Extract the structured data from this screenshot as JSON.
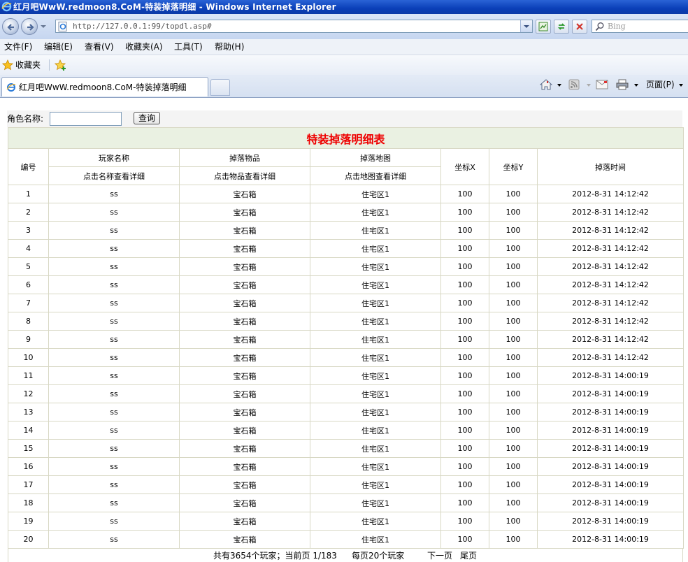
{
  "window": {
    "title": "红月吧WwW.redmoon8.CoM-特装掉落明细 - Windows Internet Explorer"
  },
  "address_bar": {
    "url": "http://127.0.0.1:99/topdl.asp#",
    "search_placeholder": "Bing"
  },
  "menu": [
    "文件(F)",
    "编辑(E)",
    "查看(V)",
    "收藏夹(A)",
    "工具(T)",
    "帮助(H)"
  ],
  "favorites_bar": {
    "label": "收藏夹"
  },
  "tab": {
    "title": "红月吧WwW.redmoon8.CoM-特装掉落明细"
  },
  "command_bar": {
    "page_label": "页面(P)"
  },
  "search": {
    "label": "角色名称:",
    "input_value": "",
    "button_label": "查询"
  },
  "table": {
    "caption": "特装掉落明细表",
    "headers": {
      "id": "编号",
      "player": "玩家名称",
      "player_hint": "点击名称查看详细",
      "item": "掉落物品",
      "item_hint": "点击物品查看详细",
      "map": "掉落地图",
      "map_hint": "点击地图查看详细",
      "x": "坐标X",
      "y": "坐标Y",
      "time": "掉落时间"
    },
    "rows": [
      {
        "id": "1",
        "player": "ss",
        "item": "宝石箱",
        "map": "住宅区1",
        "x": "100",
        "y": "100",
        "time": "2012-8-31 14:12:42"
      },
      {
        "id": "2",
        "player": "ss",
        "item": "宝石箱",
        "map": "住宅区1",
        "x": "100",
        "y": "100",
        "time": "2012-8-31 14:12:42"
      },
      {
        "id": "3",
        "player": "ss",
        "item": "宝石箱",
        "map": "住宅区1",
        "x": "100",
        "y": "100",
        "time": "2012-8-31 14:12:42"
      },
      {
        "id": "4",
        "player": "ss",
        "item": "宝石箱",
        "map": "住宅区1",
        "x": "100",
        "y": "100",
        "time": "2012-8-31 14:12:42"
      },
      {
        "id": "5",
        "player": "ss",
        "item": "宝石箱",
        "map": "住宅区1",
        "x": "100",
        "y": "100",
        "time": "2012-8-31 14:12:42"
      },
      {
        "id": "6",
        "player": "ss",
        "item": "宝石箱",
        "map": "住宅区1",
        "x": "100",
        "y": "100",
        "time": "2012-8-31 14:12:42"
      },
      {
        "id": "7",
        "player": "ss",
        "item": "宝石箱",
        "map": "住宅区1",
        "x": "100",
        "y": "100",
        "time": "2012-8-31 14:12:42"
      },
      {
        "id": "8",
        "player": "ss",
        "item": "宝石箱",
        "map": "住宅区1",
        "x": "100",
        "y": "100",
        "time": "2012-8-31 14:12:42"
      },
      {
        "id": "9",
        "player": "ss",
        "item": "宝石箱",
        "map": "住宅区1",
        "x": "100",
        "y": "100",
        "time": "2012-8-31 14:12:42"
      },
      {
        "id": "10",
        "player": "ss",
        "item": "宝石箱",
        "map": "住宅区1",
        "x": "100",
        "y": "100",
        "time": "2012-8-31 14:12:42"
      },
      {
        "id": "11",
        "player": "ss",
        "item": "宝石箱",
        "map": "住宅区1",
        "x": "100",
        "y": "100",
        "time": "2012-8-31 14:00:19"
      },
      {
        "id": "12",
        "player": "ss",
        "item": "宝石箱",
        "map": "住宅区1",
        "x": "100",
        "y": "100",
        "time": "2012-8-31 14:00:19"
      },
      {
        "id": "13",
        "player": "ss",
        "item": "宝石箱",
        "map": "住宅区1",
        "x": "100",
        "y": "100",
        "time": "2012-8-31 14:00:19"
      },
      {
        "id": "14",
        "player": "ss",
        "item": "宝石箱",
        "map": "住宅区1",
        "x": "100",
        "y": "100",
        "time": "2012-8-31 14:00:19"
      },
      {
        "id": "15",
        "player": "ss",
        "item": "宝石箱",
        "map": "住宅区1",
        "x": "100",
        "y": "100",
        "time": "2012-8-31 14:00:19"
      },
      {
        "id": "16",
        "player": "ss",
        "item": "宝石箱",
        "map": "住宅区1",
        "x": "100",
        "y": "100",
        "time": "2012-8-31 14:00:19"
      },
      {
        "id": "17",
        "player": "ss",
        "item": "宝石箱",
        "map": "住宅区1",
        "x": "100",
        "y": "100",
        "time": "2012-8-31 14:00:19"
      },
      {
        "id": "18",
        "player": "ss",
        "item": "宝石箱",
        "map": "住宅区1",
        "x": "100",
        "y": "100",
        "time": "2012-8-31 14:00:19"
      },
      {
        "id": "19",
        "player": "ss",
        "item": "宝石箱",
        "map": "住宅区1",
        "x": "100",
        "y": "100",
        "time": "2012-8-31 14:00:19"
      },
      {
        "id": "20",
        "player": "ss",
        "item": "宝石箱",
        "map": "住宅区1",
        "x": "100",
        "y": "100",
        "time": "2012-8-31 14:00:19"
      }
    ]
  },
  "pagination": {
    "summary": "共有3654个玩家；当前页 1/183",
    "per_page": "每页20个玩家",
    "next": "下一页",
    "last": "尾页"
  },
  "colors": {
    "title_bar": "#0a3fb8",
    "caption_text": "#e00000",
    "caption_bg": "#eaf1e2",
    "table_border": "#d8d8c4"
  }
}
